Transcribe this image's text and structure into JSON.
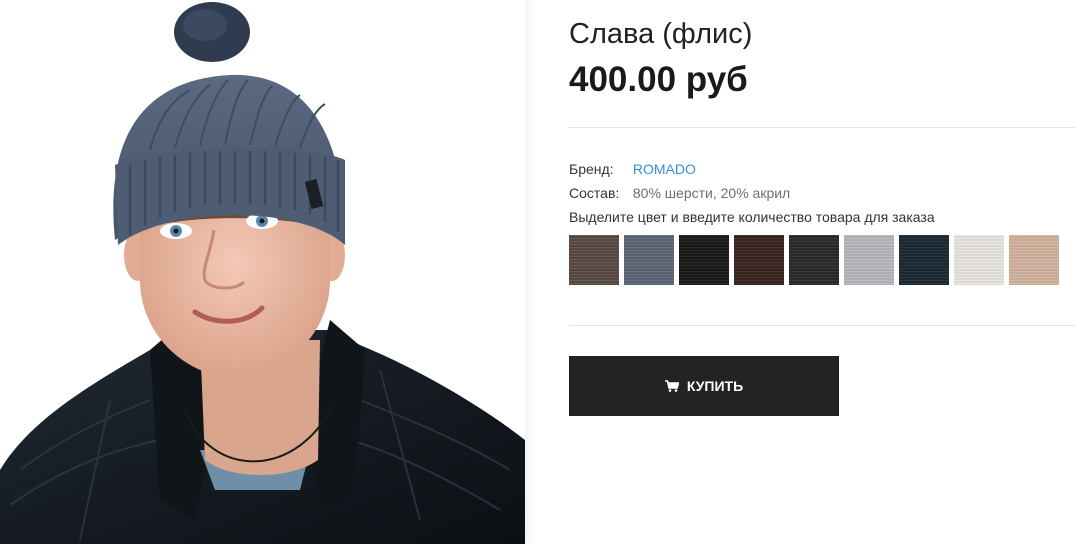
{
  "product": {
    "title": "Слава (флис)",
    "price": "400.00 руб",
    "image_alt": "Мужская вязаная шапка с помпоном"
  },
  "details": {
    "brand_label": "Бренд:",
    "brand_value": "ROMADO",
    "composition_label": "Состав:",
    "composition_value": "80% шерсти, 20% акрил",
    "color_hint": "Выделите цвет и введите количество товара для заказа"
  },
  "colors": [
    {
      "hex": "#5a4a44",
      "icon": "yarn-swatch"
    },
    {
      "hex": "#5d6676",
      "icon": "yarn-swatch"
    },
    {
      "hex": "#1b1a19",
      "icon": "yarn-swatch"
    },
    {
      "hex": "#3a2420",
      "icon": "yarn-swatch"
    },
    {
      "hex": "#2c2a28",
      "icon": "yarn-swatch"
    },
    {
      "hex": "#b9b9bd",
      "icon": "yarn-swatch"
    },
    {
      "hex": "#1c2933",
      "icon": "yarn-swatch"
    },
    {
      "hex": "#e9e6e2",
      "icon": "yarn-swatch"
    },
    {
      "hex": "#d2b49f",
      "icon": "yarn-swatch"
    }
  ],
  "buy_button": {
    "label": "КУПИТЬ",
    "icon": "cart-icon"
  }
}
